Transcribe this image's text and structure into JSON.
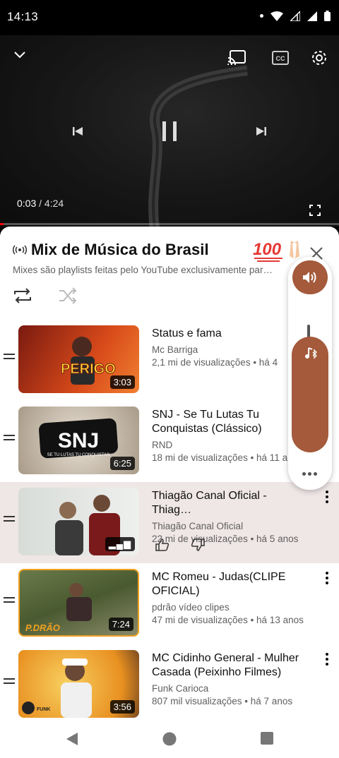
{
  "status": {
    "time": "14:13"
  },
  "player": {
    "elapsed": "0:03",
    "separator": " / ",
    "duration": "4:24",
    "progress": 0.011
  },
  "playlist": {
    "title": "Mix de Música do Brasil",
    "subtitle": "Mixes são playlists feitas pelo YouTube exclusivamente par…",
    "items": [
      {
        "title": "Status e fama",
        "channel": "Mc Barriga",
        "meta": "2,1 mi de visualizações • há 4",
        "duration": "3:03",
        "thumb_text": "PERIGO"
      },
      {
        "title": "SNJ - Se Tu Lutas Tu Conquistas (Clássico)",
        "channel": "RND",
        "meta": "18 mi de visualizações • há 11 a",
        "duration": "6:25",
        "thumb_text": "SNJ",
        "thumb_sub": "SE TU LUTAS TU CONQUISTAS"
      },
      {
        "title": "Thiagão Canal Oficial - Thiag…",
        "channel": "Thiagão Canal Oficial",
        "meta": "22 mi de visualizações • há 5 anos",
        "duration": "",
        "active": true
      },
      {
        "title": "MC Romeu - Judas(CLIPE OFICIAL)",
        "channel": "pdrão vídeo clipes",
        "meta": "47 mi de visualizações • há 13 anos",
        "duration": "7:24",
        "thumb_text": "P.DRÃO"
      },
      {
        "title": "MC Cidinho General - Mulher Casada (Peixinho Filmes)",
        "channel": "Funk Carioca",
        "meta": "807 mil visualizações • há 7 anos",
        "duration": "3:56",
        "thumb_text": "FUNK"
      }
    ]
  },
  "colors": {
    "accent": "#a45a3b",
    "active_row": "#efe6e6",
    "progress": "#ff0000"
  },
  "icons": [
    "chevron-down-icon",
    "cast-icon",
    "captions-icon",
    "settings-icon",
    "previous-icon",
    "pause-icon",
    "next-icon",
    "fullscreen-icon",
    "live-icon",
    "close-icon",
    "repeat-icon",
    "shuffle-icon",
    "volume-icon",
    "bluetooth-music-icon",
    "like-icon",
    "dislike-icon",
    "back-icon",
    "home-icon",
    "recents-icon"
  ]
}
